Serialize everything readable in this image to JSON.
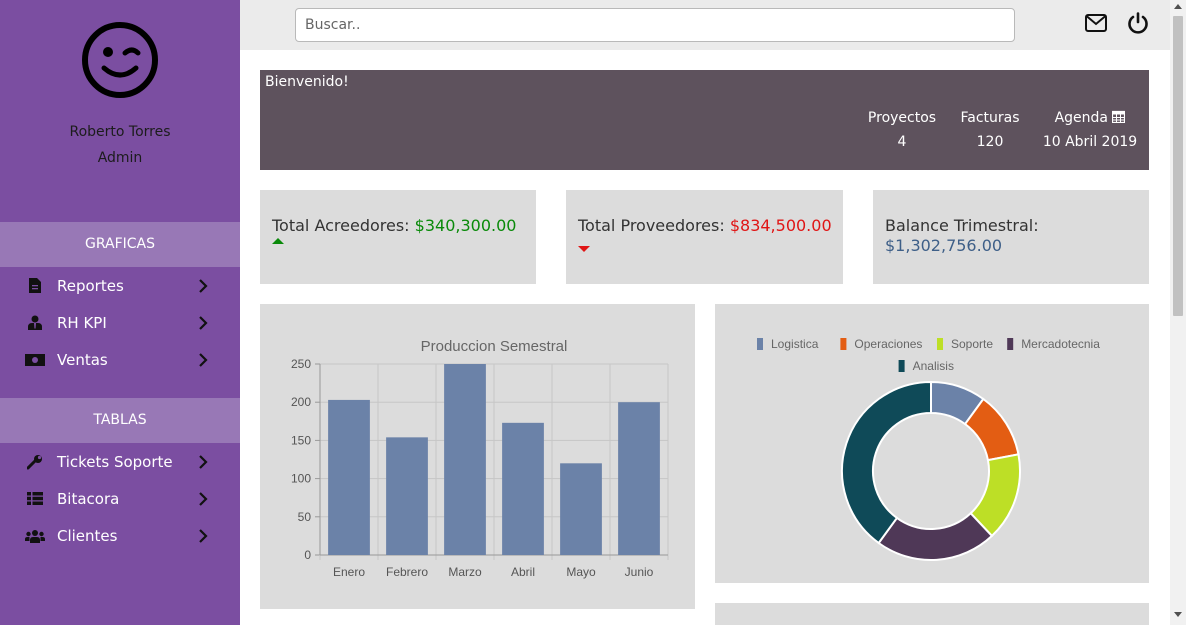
{
  "user": {
    "name": "Roberto Torres",
    "role": "Admin"
  },
  "sidebar": {
    "sections": [
      {
        "title": "GRAFICAS",
        "items": [
          {
            "label": "Reportes",
            "icon": "file-icon"
          },
          {
            "label": "RH KPI",
            "icon": "user-tie-icon"
          },
          {
            "label": "Ventas",
            "icon": "money-icon"
          }
        ]
      },
      {
        "title": "TABLAS",
        "items": [
          {
            "label": "Tickets Soporte",
            "icon": "wrench-icon"
          },
          {
            "label": "Bitacora",
            "icon": "list-icon"
          },
          {
            "label": "Clientes",
            "icon": "users-icon"
          }
        ]
      }
    ]
  },
  "topbar": {
    "search_placeholder": "Buscar..",
    "icons": [
      "mail-icon",
      "power-icon"
    ]
  },
  "banner": {
    "title": "Bienvenido!",
    "stats": [
      {
        "label": "Proyectos",
        "value": "4"
      },
      {
        "label": "Facturas",
        "value": "120"
      },
      {
        "label": "Agenda",
        "value": "10 Abril 2019",
        "icon": "calendar-icon"
      }
    ]
  },
  "kpis": [
    {
      "label": "Total Acreedores:",
      "value": "$340,300.00",
      "trend": "up"
    },
    {
      "label": "Total Proveedores:",
      "value": "$834,500.00",
      "trend": "down"
    },
    {
      "label": "Balance Trimestral:",
      "value": "$1,302,756.00"
    }
  ],
  "colors": {
    "sidebar": "#7b4ea1",
    "section_header": "#9878b6",
    "banner": "#5e525d",
    "card": "#dcdcdc",
    "positive": "#0a8a0a",
    "negative": "#e01515",
    "bar": "#6b82a8"
  },
  "chart_data": [
    {
      "type": "bar",
      "title": "Produccion Semestral",
      "categories": [
        "Enero",
        "Febrero",
        "Marzo",
        "Abril",
        "Mayo",
        "Junio"
      ],
      "values": [
        203,
        154,
        250,
        173,
        120,
        200
      ],
      "ylim": [
        0,
        250
      ],
      "yticks": [
        0,
        50,
        100,
        150,
        200,
        250
      ],
      "grid": true,
      "color": "#6b82a8"
    },
    {
      "type": "pie",
      "donut": true,
      "legend_position": "top",
      "labels": [
        "Logistica",
        "Operaciones",
        "Soporte",
        "Mercadotecnia",
        "Analisis"
      ],
      "values": [
        10,
        12,
        16,
        22,
        40
      ],
      "colors": [
        "#6b82a8",
        "#e35d13",
        "#bddf26",
        "#4f3857",
        "#0f4a58"
      ]
    }
  ]
}
